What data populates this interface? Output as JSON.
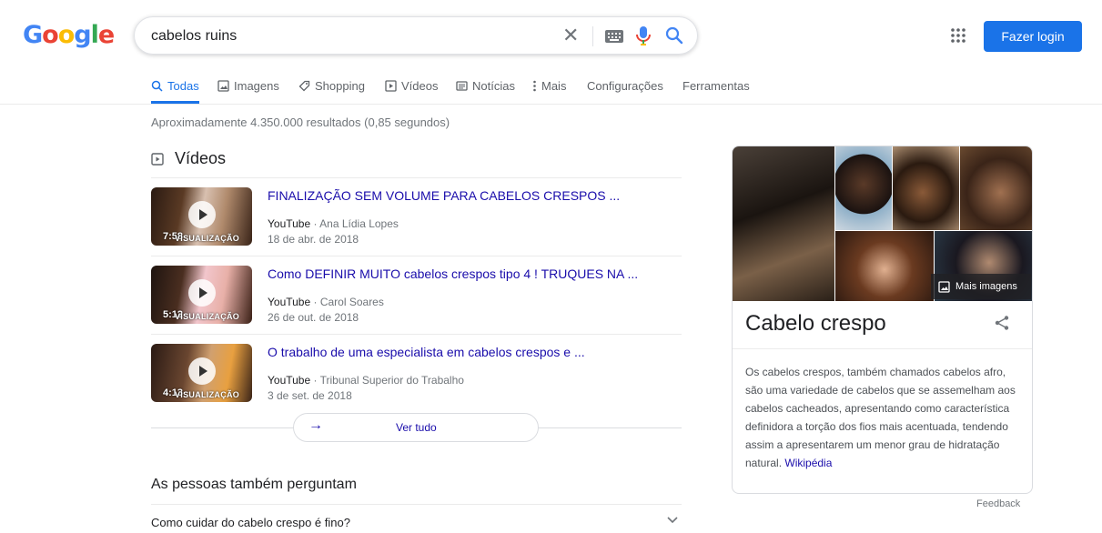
{
  "logo": {
    "letters": [
      {
        "ch": "G",
        "color": "#4285f4"
      },
      {
        "ch": "o",
        "color": "#ea4335"
      },
      {
        "ch": "o",
        "color": "#fbbc05"
      },
      {
        "ch": "g",
        "color": "#4285f4"
      },
      {
        "ch": "l",
        "color": "#34a853"
      },
      {
        "ch": "e",
        "color": "#ea4335"
      }
    ]
  },
  "search": {
    "value": "cabelos ruins"
  },
  "header": {
    "login_label": "Fazer login"
  },
  "tabs": [
    {
      "label": "Todas",
      "icon": "search-icon"
    },
    {
      "label": "Imagens",
      "icon": "image-icon"
    },
    {
      "label": "Shopping",
      "icon": "tag-icon"
    },
    {
      "label": "Vídeos",
      "icon": "video-icon"
    },
    {
      "label": "Notícias",
      "icon": "news-icon"
    },
    {
      "label": "Mais",
      "icon": "more-vert-icon"
    },
    {
      "label": "Configurações",
      "icon": ""
    },
    {
      "label": "Ferramentas",
      "icon": ""
    }
  ],
  "results": {
    "stats": "Aproximadamente 4.350.000 resultados (0,85 segundos)"
  },
  "videos": {
    "header": "Vídeos",
    "items": [
      {
        "title": "FINALIZAÇÃO SEM VOLUME PARA CABELOS CRESPOS ...",
        "source": "YouTube",
        "channel": "Ana Lídia Lopes",
        "date": "18 de abr. de 2018",
        "duration": "7:58",
        "overlay": "VISUALIZAÇÃO"
      },
      {
        "title": "Como DEFINIR MUITO cabelos crespos tipo 4 ! TRUQUES NA ...",
        "source": "YouTube",
        "channel": "Carol Soares",
        "date": "26 de out. de 2018",
        "duration": "5:12",
        "overlay": "VISUALIZAÇÃO"
      },
      {
        "title": "O trabalho de uma especialista em cabelos crespos e ...",
        "source": "YouTube",
        "channel": "Tribunal Superior do Trabalho",
        "date": "3 de set. de 2018",
        "duration": "4:13",
        "overlay": "VISUALIZAÇÃO"
      }
    ],
    "see_all": "Ver tudo"
  },
  "paa": {
    "title": "As pessoas também perguntam",
    "questions": [
      "Como cuidar do cabelo crespo é fino?"
    ]
  },
  "knowledge_panel": {
    "more_images": "Mais imagens",
    "title": "Cabelo crespo",
    "description": "Os cabelos crespos, também chamados cabelos afro, são uma variedade de cabelos que se assemelham aos cabelos cacheados, apresentando como característica definidora a torção dos fios mais acentuada, tendendo assim a apresentarem um menor grau de hidratação natural.",
    "source_link": "Wikipédia"
  },
  "feedback": "Feedback",
  "colors": {
    "accent": "#1a73e8",
    "link": "#1a0dab"
  }
}
